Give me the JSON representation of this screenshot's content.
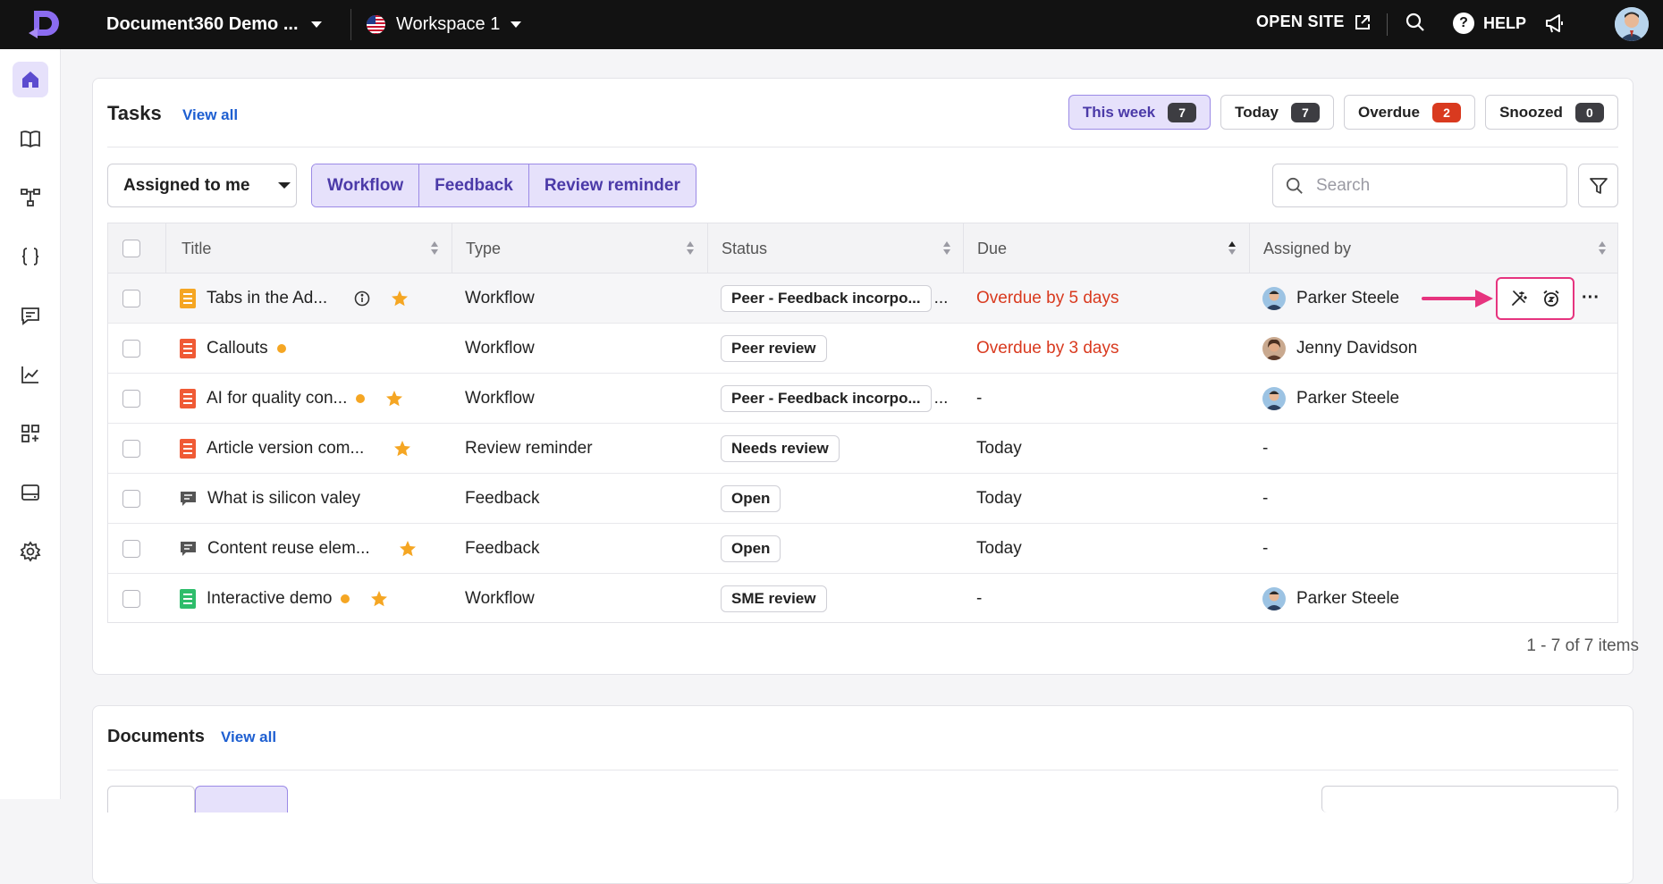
{
  "topbar": {
    "project_name": "Document360 Demo ...",
    "workspace_name": "Workspace 1",
    "open_site_label": "OPEN SITE",
    "help_label": "HELP"
  },
  "sidebar": {
    "items": [
      "home-icon",
      "book-icon",
      "category-tree-icon",
      "api-braces-icon",
      "feedback-icon",
      "analytics-icon",
      "apps-add-icon",
      "widget-icon",
      "settings-icon"
    ],
    "active": "home"
  },
  "tasks": {
    "title": "Tasks",
    "view_all": "View all",
    "periods": [
      {
        "label": "This week",
        "count": "7"
      },
      {
        "label": "Today",
        "count": "7"
      },
      {
        "label": "Overdue",
        "count": "2"
      },
      {
        "label": "Snoozed",
        "count": "0"
      }
    ],
    "assigned_filter": "Assigned to me",
    "type_filters": [
      "Workflow",
      "Feedback",
      "Review reminder"
    ],
    "search_placeholder": "Search",
    "columns": [
      "Title",
      "Type",
      "Status",
      "Due",
      "Assigned by"
    ],
    "rows": [
      {
        "title": "Tabs in the Ad...",
        "type": "Workflow",
        "status": "Peer - Feedback incorpo...",
        "due": "Overdue by 5 days",
        "assigned_by": "Parker Steele"
      },
      {
        "title": "Callouts",
        "type": "Workflow",
        "status": "Peer review",
        "due": "Overdue by 3 days",
        "assigned_by": "Jenny Davidson"
      },
      {
        "title": "AI for quality con...",
        "type": "Workflow",
        "status": "Peer - Feedback incorpo...",
        "due": "-",
        "assigned_by": "Parker Steele"
      },
      {
        "title": "Article version com...",
        "type": "Review reminder",
        "status": "Needs review",
        "due": "Today",
        "assigned_by": "-"
      },
      {
        "title": "What is silicon valey",
        "type": "Feedback",
        "status": "Open",
        "due": "Today",
        "assigned_by": "-"
      },
      {
        "title": "Content reuse elem...",
        "type": "Feedback",
        "status": "Open",
        "due": "Today",
        "assigned_by": "-"
      },
      {
        "title": "Interactive demo",
        "type": "Workflow",
        "status": "SME review",
        "due": "-",
        "assigned_by": "Parker Steele"
      }
    ],
    "status_overflow": "...",
    "more_label": "···",
    "pagination": "1 - 7 of 7 items"
  },
  "documents": {
    "title": "Documents",
    "view_all": "View all"
  },
  "colors": {
    "accent": "#5b4bcf",
    "overdue": "#d93a1f",
    "highlight": "#e6347f",
    "star": "#f5a623"
  }
}
